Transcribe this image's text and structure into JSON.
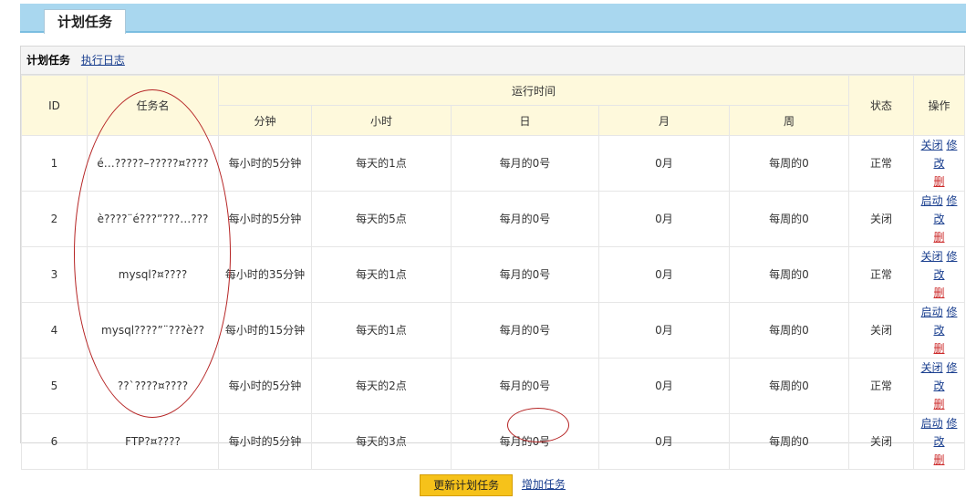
{
  "top_tab": "计划任务",
  "panel_tabs": {
    "current": "计划任务",
    "log": "执行日志"
  },
  "headers": {
    "id": "ID",
    "name": "任务名",
    "run_time": "运行时间",
    "minute": "分钟",
    "hour": "小时",
    "day": "日",
    "month": "月",
    "week": "周",
    "status": "状态",
    "ops": "操作"
  },
  "rows": [
    {
      "id": "1",
      "name": "é…?????–?????¤????",
      "minute": "每小时的5分钟",
      "hour": "每天的1点",
      "day": "每月的0号",
      "month": "0月",
      "week": "每周的0",
      "status": "正常",
      "toggle": "关闭",
      "edit": "修改",
      "delete": "删"
    },
    {
      "id": "2",
      "name": "è????¨é???”???…???",
      "minute": "每小时的5分钟",
      "hour": "每天的5点",
      "day": "每月的0号",
      "month": "0月",
      "week": "每周的0",
      "status": "关闭",
      "toggle": "启动",
      "edit": "修改",
      "delete": "删"
    },
    {
      "id": "3",
      "name": "mysql?¤????",
      "minute": "每小时的35分钟",
      "hour": "每天的1点",
      "day": "每月的0号",
      "month": "0月",
      "week": "每周的0",
      "status": "正常",
      "toggle": "关闭",
      "edit": "修改",
      "delete": "删"
    },
    {
      "id": "4",
      "name": "mysql????”¨???è??",
      "minute": "每小时的15分钟",
      "hour": "每天的1点",
      "day": "每月的0号",
      "month": "0月",
      "week": "每周的0",
      "status": "关闭",
      "toggle": "启动",
      "edit": "修改",
      "delete": "删"
    },
    {
      "id": "5",
      "name": "??`????¤????",
      "minute": "每小时的5分钟",
      "hour": "每天的2点",
      "day": "每月的0号",
      "month": "0月",
      "week": "每周的0",
      "status": "正常",
      "toggle": "关闭",
      "edit": "修改",
      "delete": "删"
    },
    {
      "id": "6",
      "name": "FTP?¤????",
      "minute": "每小时的5分钟",
      "hour": "每天的3点",
      "day": "每月的0号",
      "month": "0月",
      "week": "每周的0",
      "status": "关闭",
      "toggle": "启动",
      "edit": "修改",
      "delete": "删"
    }
  ],
  "footer": {
    "update": "更新计划任务",
    "add": "增加任务"
  },
  "colors": {
    "topbar": "#a9d7ef",
    "header_bg": "#fef9dc",
    "button": "#f6c21a",
    "annotation": "#b52323",
    "link": "#1a3f8f",
    "delete": "#cc2b2b"
  }
}
